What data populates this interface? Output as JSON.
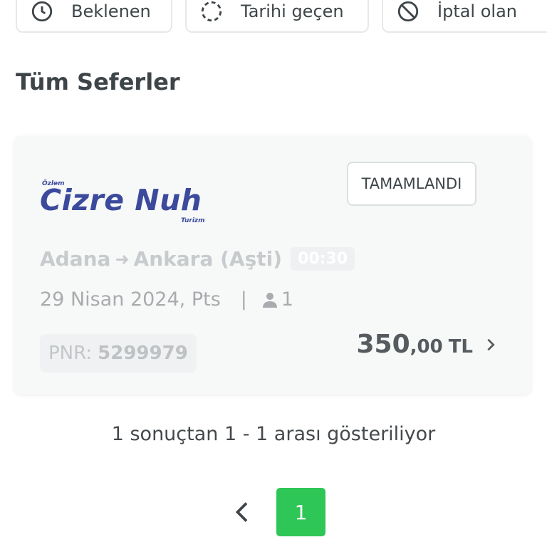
{
  "filters": [
    {
      "label": "Beklenen",
      "icon": "clock-icon"
    },
    {
      "label": "Tarihi geçen",
      "icon": "dashed-circle-icon"
    },
    {
      "label": "İptal olan",
      "icon": "cancel-circle-icon"
    }
  ],
  "section_title": "Tüm Seferler",
  "trip": {
    "operator_logo": {
      "small_top": "Özlem",
      "main": "Cizre Nuh",
      "small_bottom": "Turizm"
    },
    "status": "TAMAMLANDI",
    "from": "Adana",
    "to": "Ankara (Aşti)",
    "arrow": "➜",
    "time": "00:30",
    "date": "29 Nisan 2024, Pts",
    "separator": "|",
    "passengers": "1",
    "pnr_label": "PNR:",
    "pnr": "5299979",
    "price_whole": "350",
    "price_decimal": ",00",
    "currency": "TL"
  },
  "pagination": {
    "summary": "1 sonuçtan 1 - 1 arası gösteriliyor",
    "current_page": "1"
  },
  "colors": {
    "accent": "#2ec656",
    "brand": "#3b4a9c"
  }
}
